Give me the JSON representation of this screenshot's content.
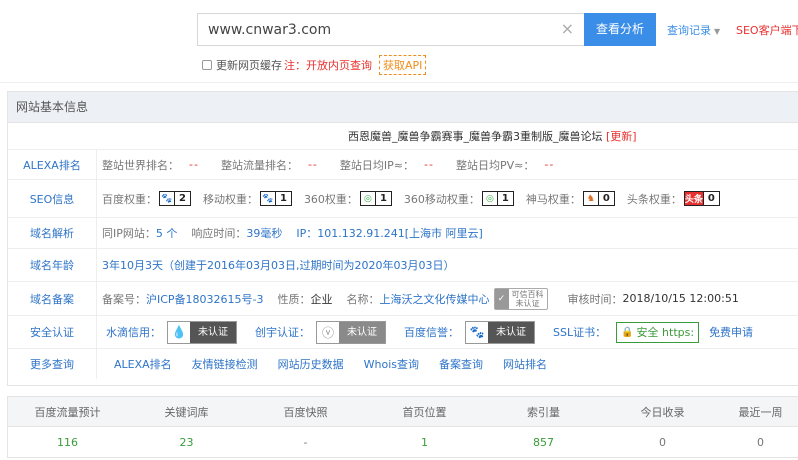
{
  "search": {
    "value": "www.cnwar3.com",
    "clear_icon": "×",
    "button_label": "查看分析",
    "history_label": "查询记录",
    "seo_link": "SEO客户端下"
  },
  "cache": {
    "label": "更新网页缓存",
    "note": "注：开放内页查询",
    "api_label": "获取API"
  },
  "panel": {
    "title": "网站基本信息",
    "site_title": "西恩魔兽_魔兽争霸赛事_魔兽争霸3重制版_魔兽论坛",
    "update_label": "[更新]"
  },
  "alexa": {
    "label": "ALEXA排名",
    "items": [
      {
        "name": "整站世界排名：",
        "value": "--"
      },
      {
        "name": "整站流量排名：",
        "value": "--"
      },
      {
        "name": "整站日均IP≈：",
        "value": "--"
      },
      {
        "name": "整站日均PV≈：",
        "value": "--"
      }
    ]
  },
  "seo": {
    "label": "SEO信息",
    "items": [
      {
        "name": "百度权重：",
        "value": "2",
        "icon": "paw-icon"
      },
      {
        "name": "移动权重：",
        "value": "1",
        "icon": "paw-icon"
      },
      {
        "name": "360权重：",
        "value": "1",
        "icon": "so360-icon"
      },
      {
        "name": "360移动权重：",
        "value": "1",
        "icon": "so360-icon"
      },
      {
        "name": "神马权重：",
        "value": "0",
        "icon": "shenma-icon"
      },
      {
        "name": "头条权重：",
        "value": "0",
        "icon": "toutiao-icon",
        "icon_text": "头条"
      }
    ]
  },
  "domain": {
    "label": "域名解析",
    "same_ip_label": "同IP网站：",
    "same_ip_value": "5 个",
    "response_label": "响应时间：",
    "response_value": "39毫秒",
    "ip_text": "IP：101.132.91.241[上海市 阿里云]"
  },
  "age": {
    "label": "域名年龄",
    "value": "3年10月3天（创建于2016年03月03日,过期时间为2020年03月03日）"
  },
  "icp": {
    "label": "域名备案",
    "number_label": "备案号：",
    "number_value": "沪ICP备18032615号-3",
    "nature_label": "性质：",
    "nature_value": "企业",
    "name_label": "名称：",
    "name_value": "上海沃之文化传媒中心",
    "trust_line1": "可信百科",
    "trust_line2": "未认证",
    "time_label": "审核时间：",
    "time_value": "2018/10/15 12:00:51"
  },
  "security": {
    "label": "安全认证",
    "shuidi_label": "水滴信用：",
    "shuidi_status": "未认证",
    "chuangshi_label": "创宇认证：",
    "chuangshi_status": "未认证",
    "baidu_label": "百度信誉：",
    "baidu_status": "未认证",
    "ssl_label": "SSL证书：",
    "ssl_badge": "安全 https:",
    "free_apply": "免费申请"
  },
  "more": {
    "label": "更多查询",
    "links": [
      "ALEXA排名",
      "友情链接检测",
      "网站历史数据",
      "Whois查询",
      "备案查询",
      "网站排名"
    ]
  },
  "stats": {
    "headers": [
      "百度流量预计",
      "关键词库",
      "百度快照",
      "首页位置",
      "索引量",
      "今日收录",
      "最近一周"
    ],
    "values": [
      "116",
      "23",
      "-",
      "1",
      "857",
      "0",
      "0"
    ]
  },
  "colors": {
    "accent": "#3b8ee8",
    "link": "#2e74c8",
    "alert": "#e8312f",
    "green": "#3a9b3a"
  }
}
